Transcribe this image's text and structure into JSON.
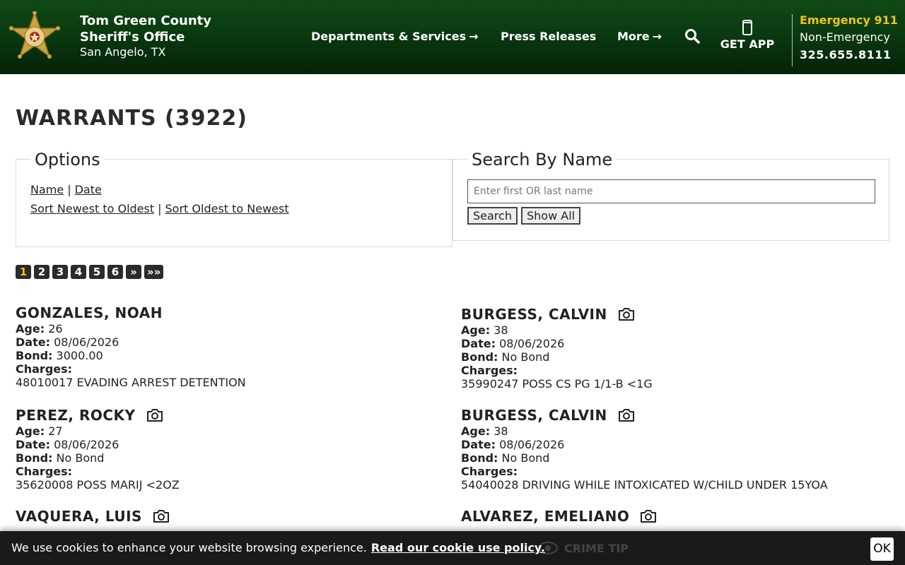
{
  "header": {
    "org_line1": "Tom Green County",
    "org_line2": "Sheriff's Office",
    "location": "San Angelo, TX",
    "nav": [
      {
        "label": "Departments & Services",
        "arrow": "→"
      },
      {
        "label": "Press Releases"
      },
      {
        "label": "More",
        "arrow": "→"
      }
    ],
    "search_icon": "search-icon",
    "app_label": "GET APP",
    "emergency_label": "Emergency 911",
    "non_emergency_label": "Non-Emergency",
    "non_emergency_phone": "325.655.8111",
    "accent_color": "#f2c21b"
  },
  "page": {
    "title": "WARRANTS (3922)"
  },
  "options": {
    "legend": "Options",
    "sort_name": "Name",
    "sort_date": "Date",
    "sort_newest": "Sort Newest to Oldest",
    "sort_oldest": "Sort Oldest to Newest",
    "separator": "|"
  },
  "search": {
    "legend": "Search By Name",
    "placeholder": "Enter first OR last name",
    "value": "",
    "search_button": "Search",
    "show_all_button": "Show All"
  },
  "pagination": {
    "pages": [
      "1",
      "2",
      "3",
      "4",
      "5",
      "6",
      "»",
      "»»"
    ],
    "current": "1"
  },
  "labels": {
    "age": "Age:",
    "date": "Date:",
    "bond": "Bond:",
    "charges": "Charges:"
  },
  "records": [
    {
      "name": "GONZALES, NOAH",
      "photo": false,
      "age": "26",
      "date": "08/06/2026",
      "bond": "3000.00",
      "charges": "48010017 EVADING ARREST DETENTION"
    },
    {
      "name": "BURGESS, CALVIN",
      "photo": true,
      "age": "38",
      "date": "08/06/2026",
      "bond": "No Bond",
      "charges": "35990247 POSS CS PG 1/1-B <1G"
    },
    {
      "name": "PEREZ, ROCKY",
      "photo": true,
      "age": "27",
      "date": "08/06/2026",
      "bond": "No Bond",
      "charges": "35620008 POSS MARIJ <2OZ"
    },
    {
      "name": "BURGESS, CALVIN",
      "photo": true,
      "age": "38",
      "date": "08/06/2026",
      "bond": "No Bond",
      "charges": "54040028 DRIVING WHILE INTOXICATED W/CHILD UNDER 15YOA"
    },
    {
      "name": "VAQUERA, LUIS",
      "photo": true
    },
    {
      "name": "ALVAREZ, EMELIANO",
      "photo": true
    }
  ],
  "cookie": {
    "message": "We use cookies to enhance your website browsing experience.",
    "policy_link": "Read our cookie use policy.",
    "ok_label": "OK",
    "behind_text": "CRIME TIP"
  }
}
